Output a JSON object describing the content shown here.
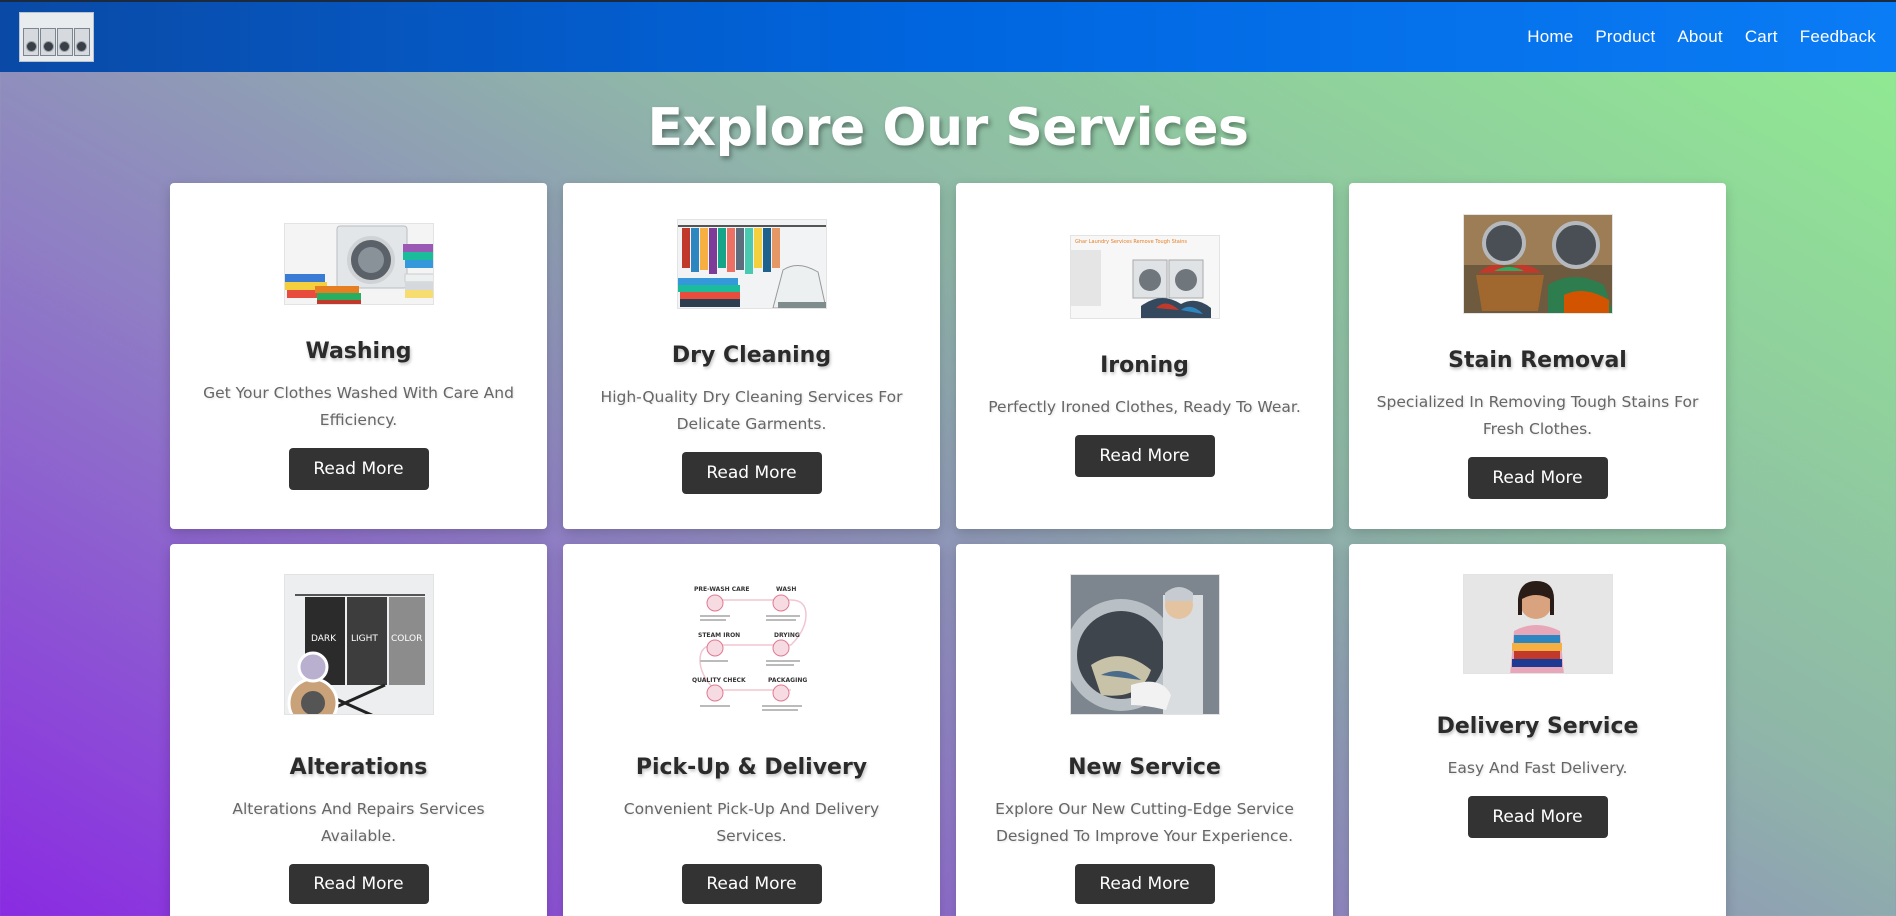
{
  "nav": {
    "logo_icon": "washing-machines-logo",
    "links": [
      "Home",
      "Product",
      "About",
      "Cart",
      "Feedback"
    ]
  },
  "page": {
    "title": "Explore Our Services"
  },
  "services": [
    {
      "title": "Washing",
      "description": "Get Your Clothes Washed With Care And Efficiency.",
      "button": "Read More",
      "image": "washing-machine-with-towels"
    },
    {
      "title": "Dry Cleaning",
      "description": "High-Quality Dry Cleaning Services For Delicate Garments.",
      "button": "Read More",
      "image": "clothes-rack-and-iron"
    },
    {
      "title": "Ironing",
      "description": "Perfectly Ironed Clothes, Ready To Wear.",
      "button": "Read More",
      "image": "laundry-room-washers"
    },
    {
      "title": "Stain Removal",
      "description": "Specialized In Removing Tough Stains For Fresh Clothes.",
      "button": "Read More",
      "image": "laundry-basket-with-washers"
    },
    {
      "title": "Alterations",
      "description": "Alterations And Repairs Services Available.",
      "button": "Read More",
      "image": "laundry-sorter-hamper"
    },
    {
      "title": "Pick-Up & Delivery",
      "description": "Convenient Pick-Up And Delivery Services.",
      "button": "Read More",
      "image": "laundry-process-infographic"
    },
    {
      "title": "New Service",
      "description": "Explore Our New Cutting-Edge Service Designed To Improve Your Experience.",
      "button": "Read More",
      "image": "industrial-washer-worker"
    },
    {
      "title": "Delivery Service",
      "description": "Easy And Fast Delivery.",
      "button": "Read More",
      "image": "woman-holding-folded-clothes"
    }
  ],
  "infographic": {
    "labels": [
      "PRE-WASH CARE",
      "WASH",
      "STEAM IRON",
      "DRYING",
      "QUALITY CHECK",
      "PACKAGING"
    ],
    "accent": "#e07a93"
  },
  "ironing_banner": "Ghar Laundry Services Remove Tough Stains",
  "hamper_labels": [
    "DARK",
    "LIGHT",
    "COLOR"
  ],
  "colors": {
    "button_bg": "#333333",
    "nav_start": "#0a4aa6",
    "nav_end": "#0a7cf5",
    "bg_purple": "#8a2be2",
    "bg_green": "#90ee90"
  }
}
